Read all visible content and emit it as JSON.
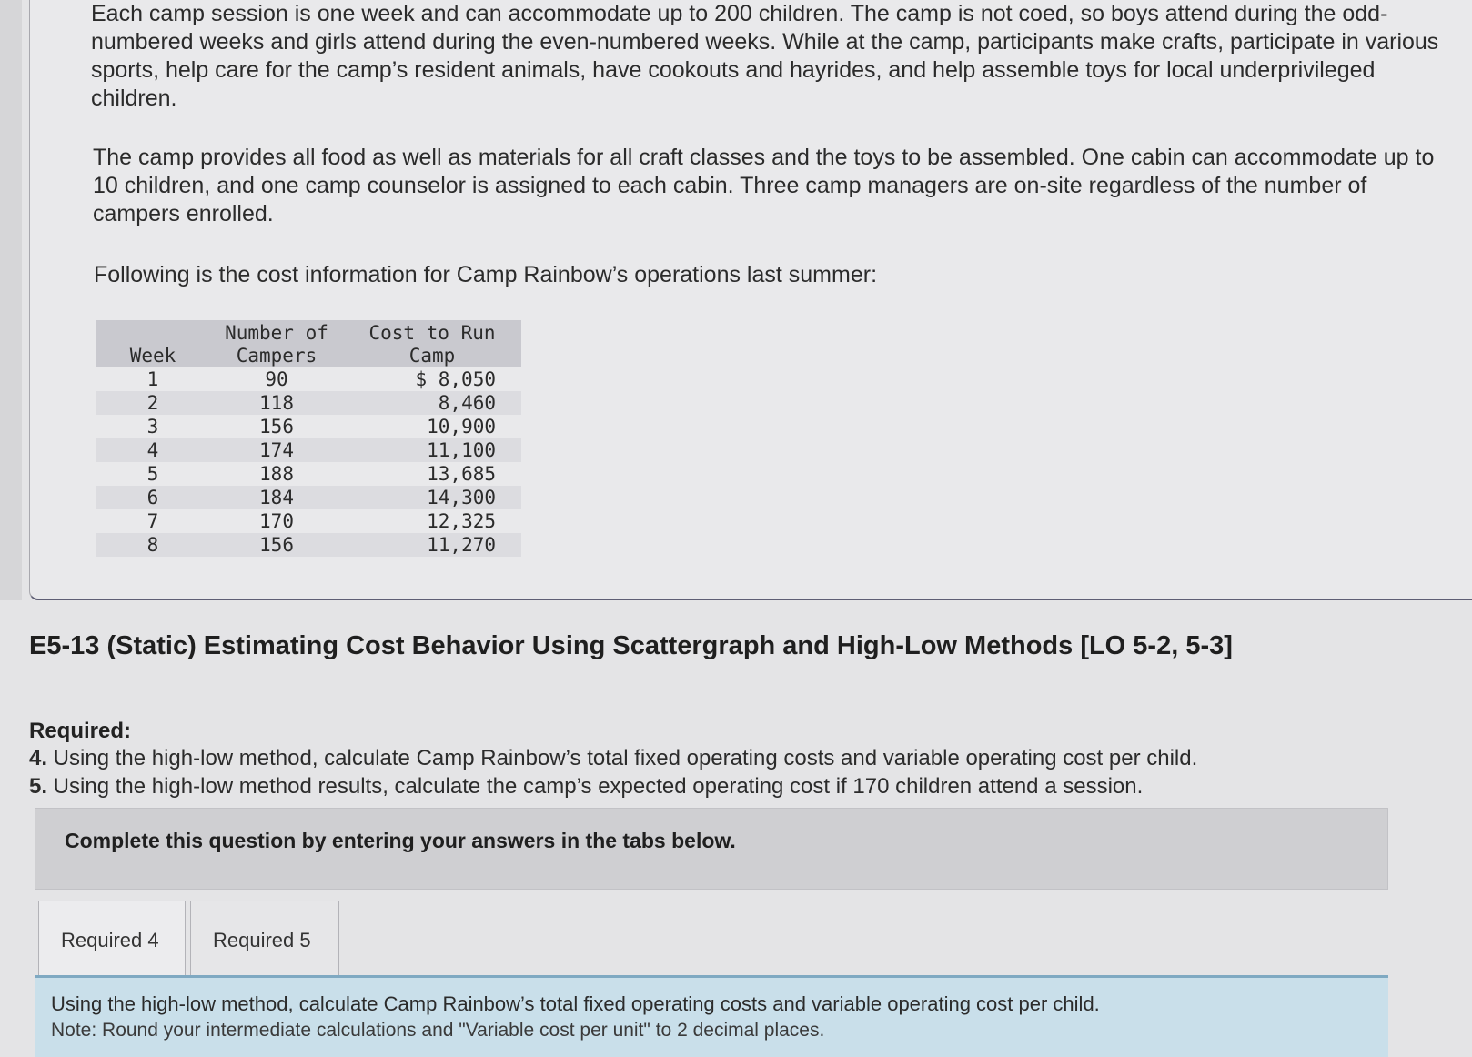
{
  "context": {
    "paragraph1": "Each camp session is one week and can accommodate up to 200 children. The camp is not coed, so boys attend during the odd-numbered weeks and girls attend during the even-numbered weeks. While at the camp, participants make crafts, participate in various sports, help care for the camp’s resident animals, have cookouts and hayrides, and help assemble toys for local underprivileged children.",
    "paragraph2": "The camp provides all food as well as materials for all craft classes and the toys to be assembled. One cabin can accommodate up to 10 children, and one camp counselor is assigned to each cabin. Three camp managers are on-site regardless of the number of campers enrolled.",
    "paragraph3": "Following is the cost information for Camp Rainbow’s operations last summer:"
  },
  "table": {
    "headers": [
      "Week",
      "Number of Campers",
      "Cost to Run Camp"
    ],
    "rows": [
      [
        "1",
        "90",
        "$ 8,050"
      ],
      [
        "2",
        "118",
        "8,460"
      ],
      [
        "3",
        "156",
        "10,900"
      ],
      [
        "4",
        "174",
        "11,100"
      ],
      [
        "5",
        "188",
        "13,685"
      ],
      [
        "6",
        "184",
        "14,300"
      ],
      [
        "7",
        "170",
        "12,325"
      ],
      [
        "8",
        "156",
        "11,270"
      ]
    ]
  },
  "exercise": {
    "title": "E5-13 (Static) Estimating Cost Behavior Using Scattergraph and High-Low Methods [LO 5-2, 5-3]",
    "required_heading": "Required:",
    "items": [
      {
        "number": "4.",
        "text": " Using the high-low method, calculate Camp Rainbow’s total fixed operating costs and variable operating cost per child."
      },
      {
        "number": "5.",
        "text": " Using the high-low method results, calculate the camp’s expected operating cost if 170 children attend a session."
      }
    ],
    "notice": "Complete this question by entering your answers in the tabs below."
  },
  "tabs": [
    {
      "label": "Required 4",
      "active": true
    },
    {
      "label": "Required 5",
      "active": false
    }
  ],
  "panel": {
    "instruction": "Using the high-low method, calculate Camp Rainbow’s total fixed operating costs and variable operating cost per child.",
    "note": "Note: Round your intermediate calculations and \"Variable cost per unit\" to 2 decimal places."
  }
}
